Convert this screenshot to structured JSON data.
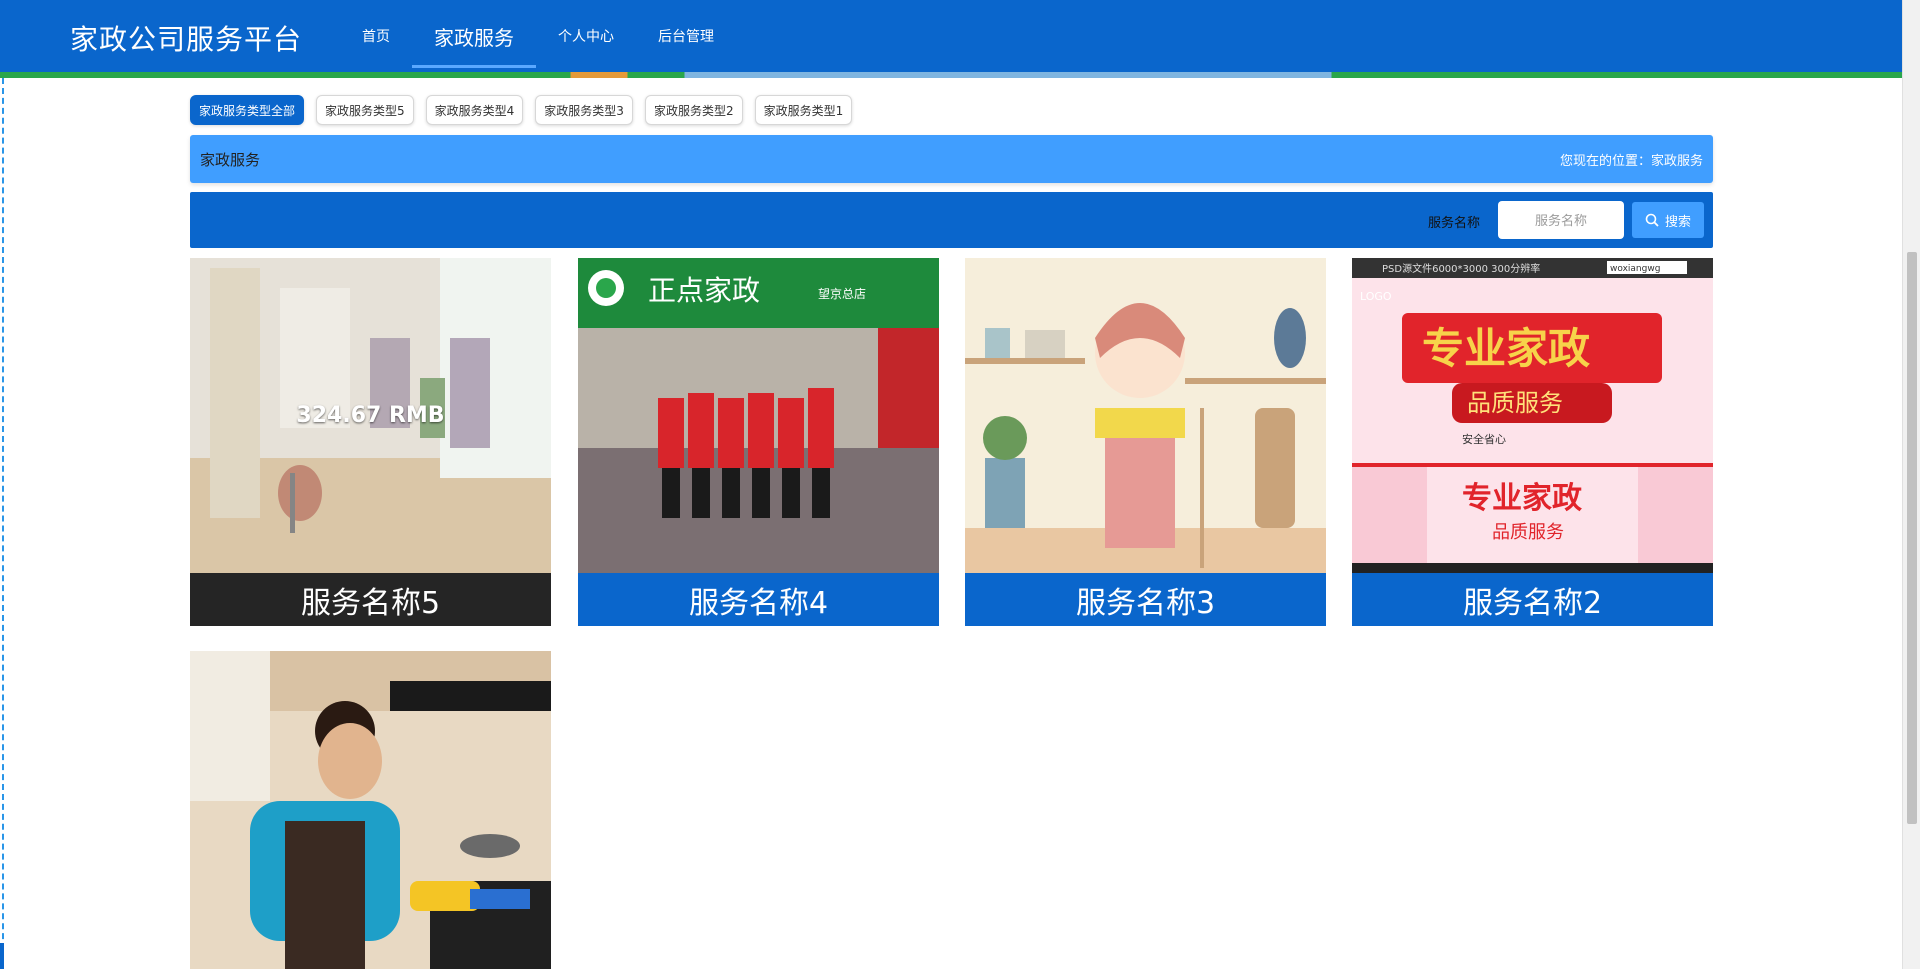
{
  "header": {
    "brand": "家政公司服务平台",
    "nav": [
      {
        "label": "首页"
      },
      {
        "label": "家政服务"
      },
      {
        "label": "个人中心"
      },
      {
        "label": "后台管理"
      }
    ]
  },
  "categories": [
    {
      "label": "家政服务类型全部",
      "active": true
    },
    {
      "label": "家政服务类型5"
    },
    {
      "label": "家政服务类型4"
    },
    {
      "label": "家政服务类型3"
    },
    {
      "label": "家政服务类型2"
    },
    {
      "label": "家政服务类型1"
    }
  ],
  "breadcrumb": {
    "title": "家政服务",
    "location": "您现在的位置：家政服务"
  },
  "search": {
    "label": "服务名称",
    "placeholder": "服务名称",
    "button_label": "搜索"
  },
  "cards": [
    {
      "title": "服务名称5",
      "price": "324.67 RMB"
    },
    {
      "title": "服务名称4"
    },
    {
      "title": "服务名称3"
    },
    {
      "title": "服务名称2"
    },
    {
      "title": ""
    }
  ],
  "card_images": {
    "card2_sign": "正点家政",
    "card2_branch": "望京总店",
    "card4_top_text": "PSD源文件6000*3000  300分辨率",
    "card4_search_text": "woxiangwg",
    "card4_logo": "LOGO",
    "card4_main_line1": "专业家政",
    "card4_main_line2": "品质服务",
    "card4_badges": "安全省心",
    "card4_small_line1": "专业家政",
    "card4_small_line2": "品质服务"
  },
  "colors": {
    "primary": "#0a66cc",
    "accent": "#409eff",
    "dark_title": "#252525"
  }
}
